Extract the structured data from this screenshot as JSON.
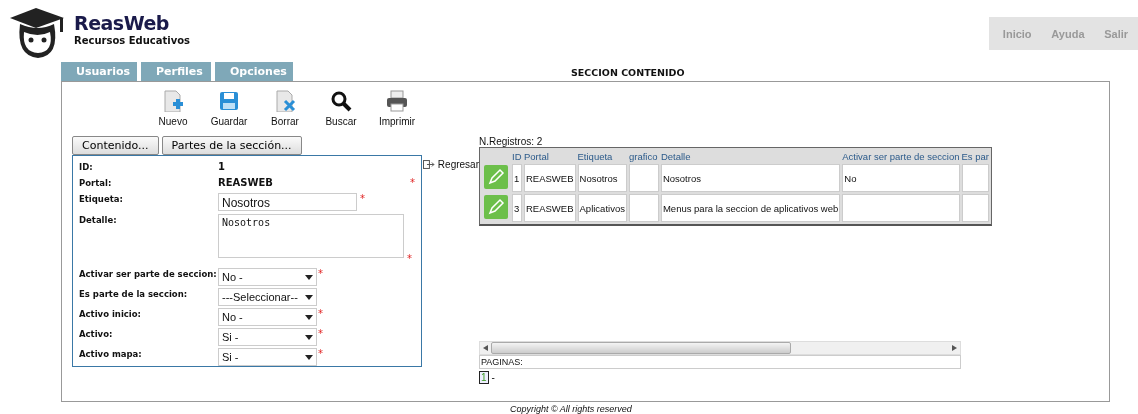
{
  "brand": {
    "name": "ReasWeb",
    "tagline": "Recursos Educativos"
  },
  "top_nav": [
    "Inicio",
    "Ayuda",
    "Salir"
  ],
  "tabs": [
    "Usuarios",
    "Perfiles",
    "Opciones"
  ],
  "page_title": "SECCION CONTENIDO",
  "toolbar": [
    {
      "label": "Nuevo",
      "kind": "new"
    },
    {
      "label": "Guardar",
      "kind": "save"
    },
    {
      "label": "Borrar",
      "kind": "delete"
    },
    {
      "label": "Buscar",
      "kind": "search"
    },
    {
      "label": "Imprimir",
      "kind": "print"
    }
  ],
  "form_buttons": [
    "Contenido...",
    "Partes de la sección..."
  ],
  "form": [
    {
      "label": "ID:",
      "kind": "text",
      "value": "1"
    },
    {
      "label": "Portal:",
      "kind": "text",
      "value": "REASWEB",
      "required_mark": "*"
    },
    {
      "label": "Etiqueta:",
      "kind": "input",
      "value": "Nosotros",
      "required_mark": "*"
    },
    {
      "label": "Detalle:",
      "kind": "textarea",
      "value": "Nosotros",
      "required_mark": "*"
    },
    {
      "label": "Activar ser parte de seccion:",
      "kind": "select",
      "value": "No -",
      "required_mark": "*"
    },
    {
      "label": "Es parte de la seccion:",
      "kind": "select",
      "value": "---Seleccionar--"
    },
    {
      "label": "Activo inicio:",
      "kind": "select",
      "value": "No -",
      "required_mark": "*"
    },
    {
      "label": "Activo:",
      "kind": "select",
      "value": "Si -",
      "required_mark": "*"
    },
    {
      "label": "Activo mapa:",
      "kind": "select",
      "value": "Si -",
      "required_mark": "*"
    }
  ],
  "back_link": "Regresar",
  "record_count": "N.Registros: 2",
  "table": {
    "columns": [
      "ID",
      "Portal",
      "Etiqueta",
      "grafico",
      "Detalle",
      "Activar ser parte de seccion",
      "Es par"
    ],
    "rows": [
      [
        "1",
        "REASWEB",
        "Nosotros",
        "",
        "Nosotros",
        "No",
        ""
      ],
      [
        "3",
        "REASWEB",
        "Aplicativos",
        "",
        "Menus para la seccion de aplicativos web",
        "",
        ""
      ]
    ]
  },
  "pager_label": "PAGINAS:",
  "pages": [
    {
      "label": "1",
      "selected": true
    }
  ],
  "pages_end": "-",
  "footer": "Copyright © All rights reserved"
}
